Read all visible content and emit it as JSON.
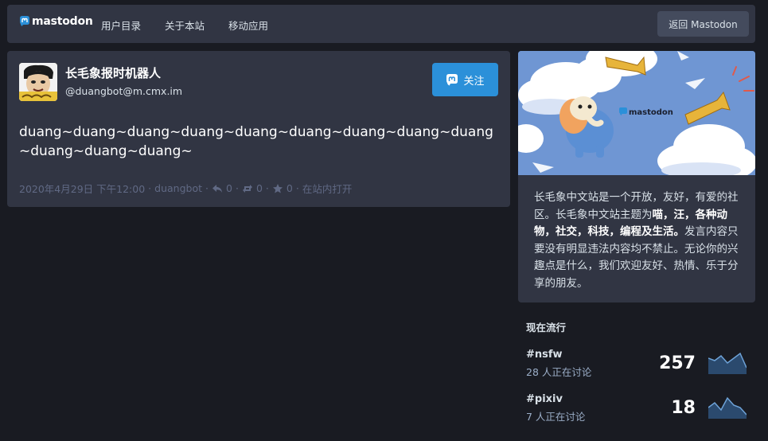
{
  "nav": {
    "logo_text": "mastodon",
    "links": [
      "用户目录",
      "关于本站",
      "移动应用"
    ],
    "back_label": "返回 Mastodon"
  },
  "status": {
    "display_name": "长毛象报时机器人",
    "acct": "@duangbot@m.cmx.im",
    "follow_label": "关注",
    "content": "duang~duang~duang~duang~duang~duang~duang~duang~duang~duang~duang~duang~",
    "timestamp": "2020年4月29日 下午12:00",
    "app": "duangbot",
    "replies": "0",
    "boosts": "0",
    "favourites": "0",
    "open_label": "在站内打开"
  },
  "about": {
    "part1": "长毛象中文站是一个开放，友好，有爱的社区。长毛象中文站主题为",
    "bold": "喵，汪，各种动物，社交，科技，编程及生活。",
    "part2": "发言内容只要没有明显违法内容均不禁止。无论你的兴趣点是什么，我们欢迎友好、热情、乐于分享的朋友。",
    "hero_logo": "mastodon"
  },
  "trends": {
    "title": "现在流行",
    "items": [
      {
        "tag": "#nsfw",
        "talking": "28 人正在讨论",
        "count": "257",
        "sparkline": [
          6,
          5,
          7,
          4,
          6,
          8,
          2
        ]
      },
      {
        "tag": "#pixiv",
        "talking": "7 人正在讨论",
        "count": "18",
        "sparkline": [
          4,
          6,
          3,
          8,
          5,
          4,
          1
        ]
      }
    ]
  },
  "colors": {
    "background": "#191b22",
    "card": "#313543",
    "accent": "#2b90d9",
    "muted": "#606984"
  }
}
